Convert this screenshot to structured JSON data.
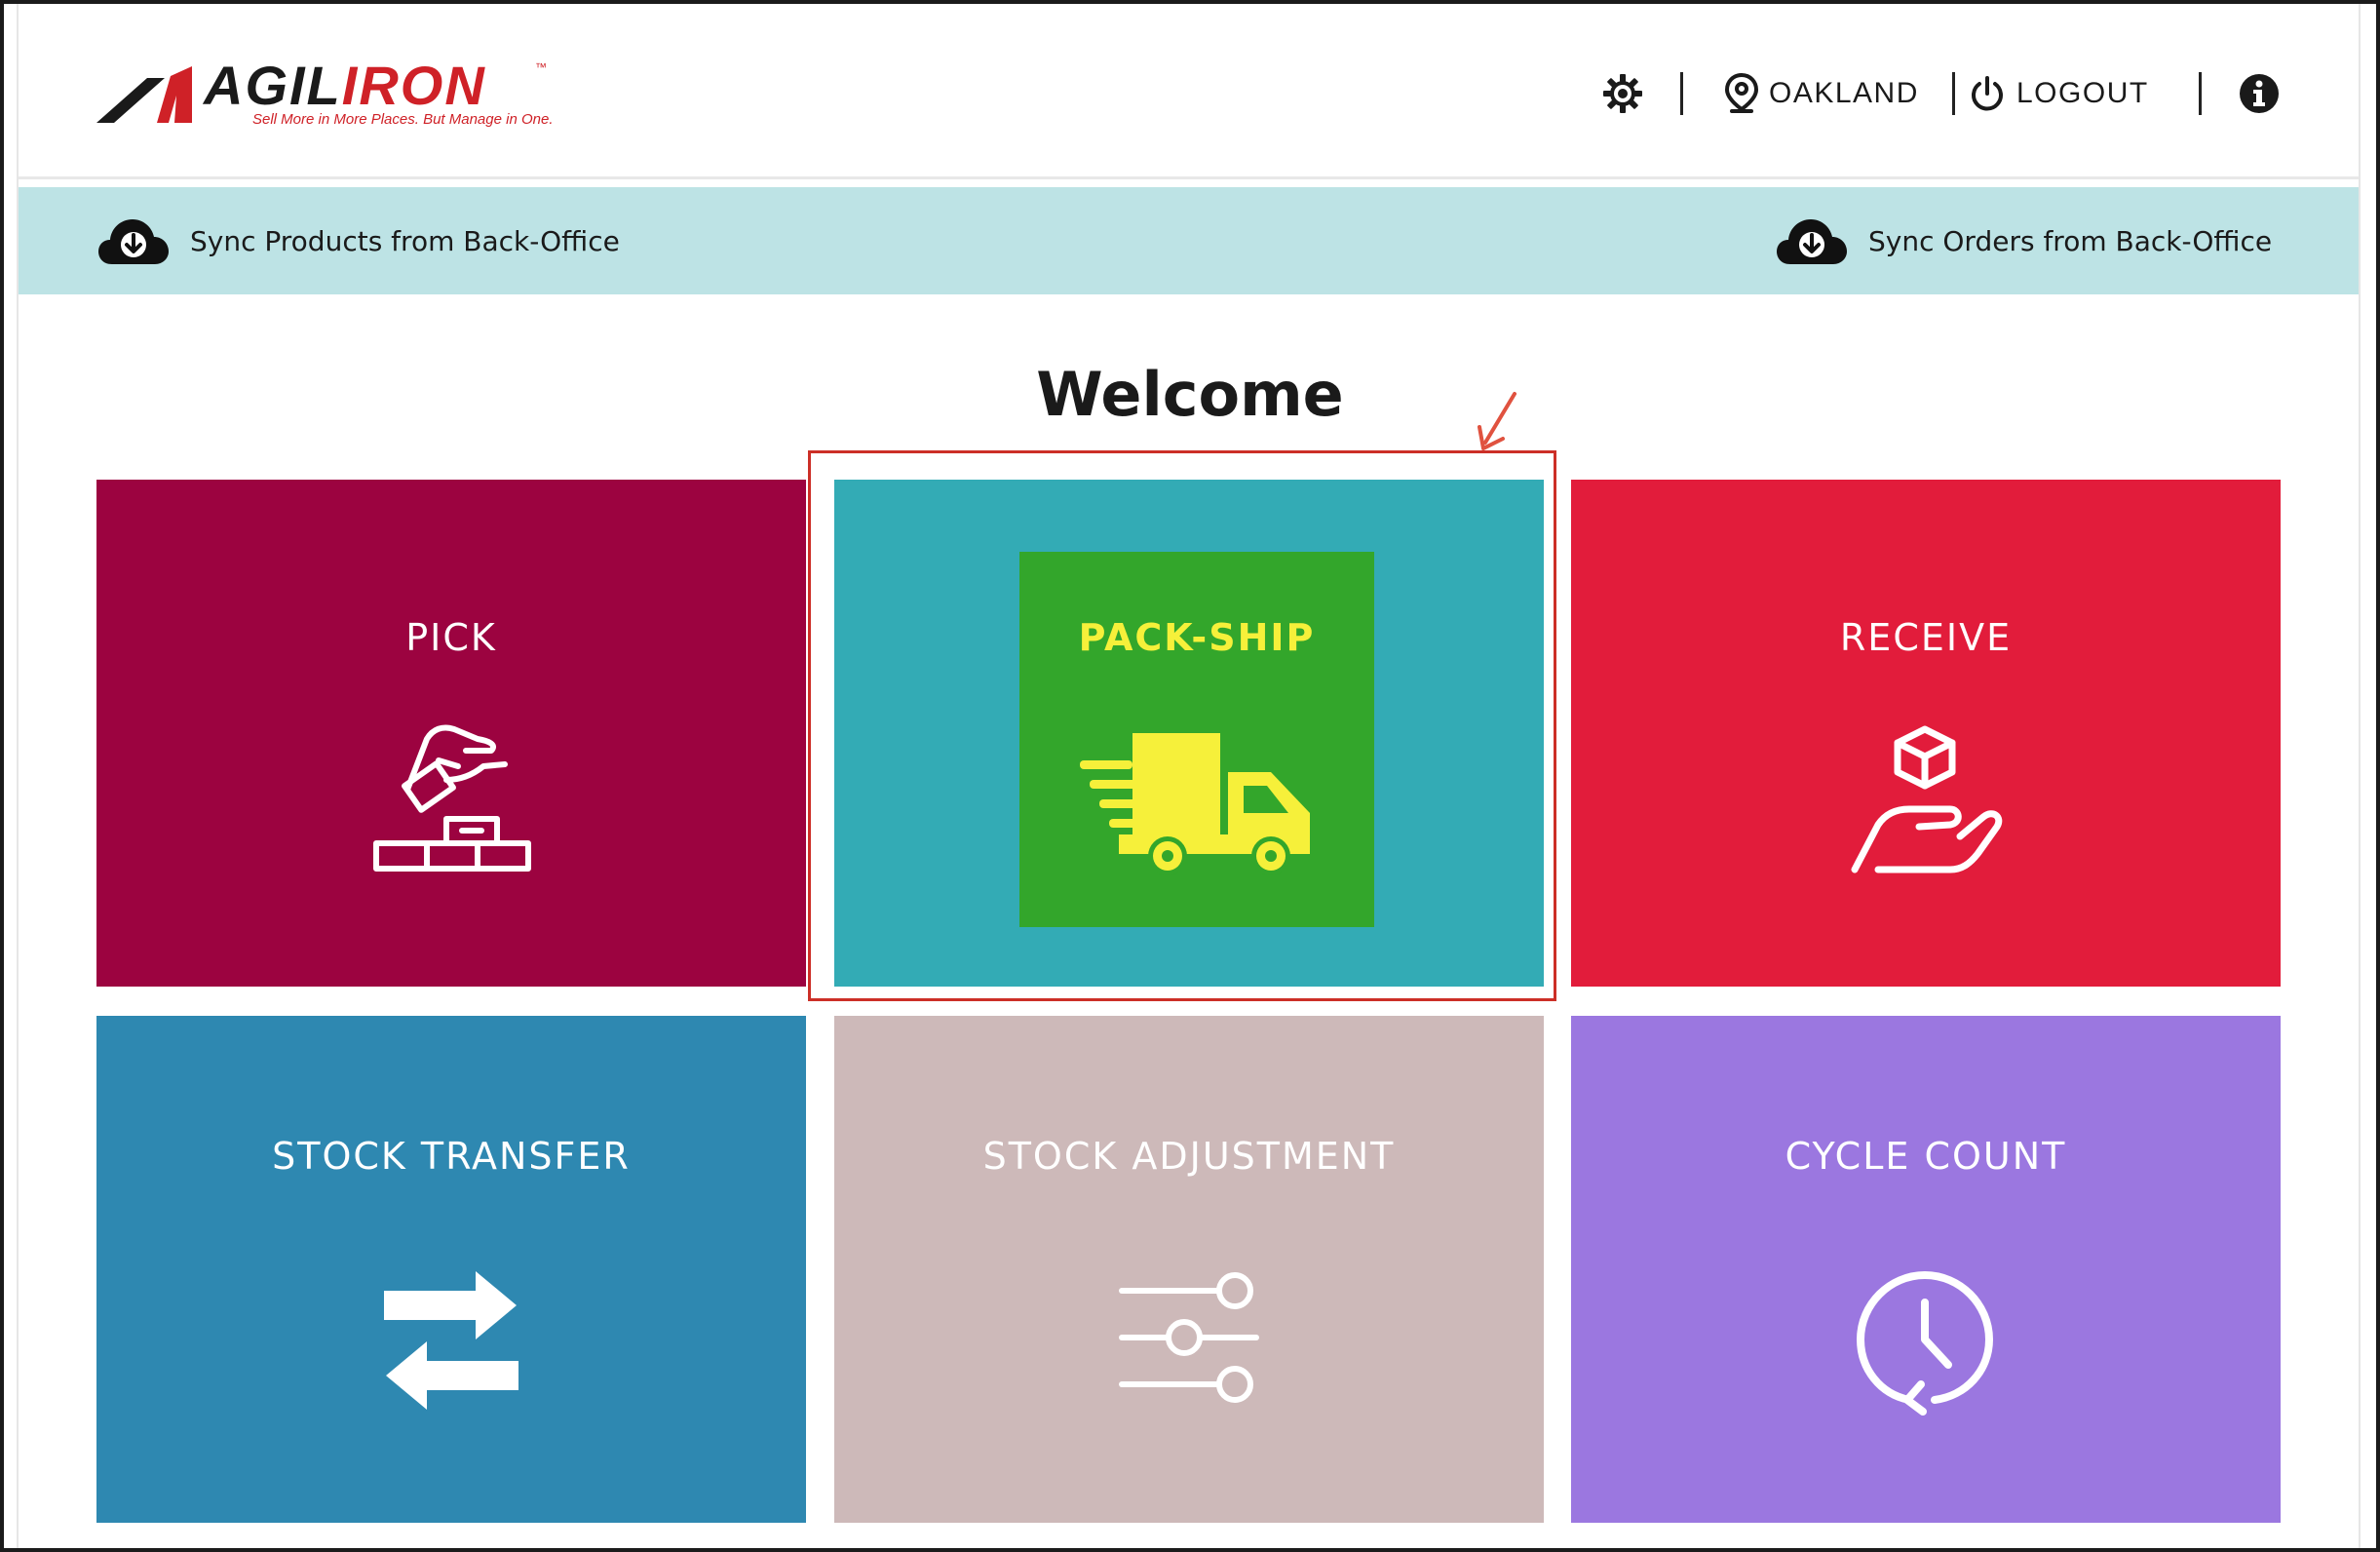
{
  "brand": {
    "logo_text_dark": "AGIL",
    "logo_text_red": "IRON",
    "tagline": "Sell More in More Places. But Manage in One.",
    "trademark": "™"
  },
  "header": {
    "location": "OAKLAND",
    "logout": "LOGOUT"
  },
  "sync": {
    "products": "Sync Products from Back-Office",
    "orders": "Sync Orders from Back-Office"
  },
  "page": {
    "title": "Welcome"
  },
  "tiles": [
    {
      "label": "PICK",
      "color": "#9c0340",
      "icon": "hand-pick-boxes-icon"
    },
    {
      "label": "PACK-SHIP",
      "color": "#33abb5",
      "inner_color": "#33a62b",
      "label_color": "#f6f03a",
      "icon": "delivery-truck-icon"
    },
    {
      "label": "RECEIVE",
      "color": "#e21c3b",
      "icon": "hand-holding-box-icon"
    },
    {
      "label": "STOCK TRANSFER",
      "color": "#2e88b1",
      "icon": "transfer-arrows-icon"
    },
    {
      "label": "STOCK ADJUSTMENT",
      "color": "#cdb9b9",
      "icon": "sliders-icon"
    },
    {
      "label": "CYCLE COUNT",
      "color": "#9b77e0",
      "icon": "history-clock-icon"
    }
  ],
  "colors": {
    "sync_bar": "#bde3e5",
    "highlight_box": "#cc2f27",
    "brand_red": "#cf2127"
  }
}
